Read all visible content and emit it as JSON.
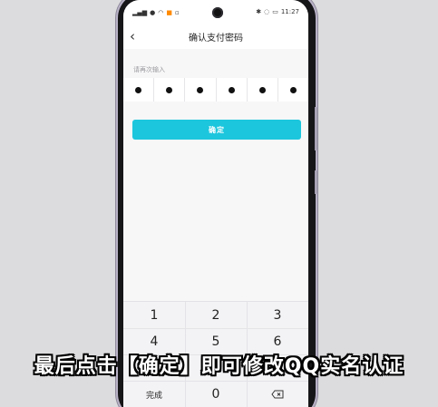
{
  "status_bar": {
    "left_icons": [
      "signal-icon",
      "signal-icon",
      "wechat-icon",
      "sms-icon",
      "wifi-icon",
      "app-icon",
      "app-icon",
      "misc-icon"
    ],
    "time": "11:27",
    "right_icons": [
      "bluetooth-icon",
      "mute-icon",
      "battery-icon"
    ]
  },
  "nav": {
    "back_icon": "chevron-left-icon",
    "title": "确认支付密码"
  },
  "form": {
    "hint": "请再次输入",
    "pin_length": 6,
    "pin_filled": 6,
    "confirm_label": "确定"
  },
  "keypad": {
    "row1": [
      "1",
      "2",
      "3"
    ],
    "row2": [
      "4",
      "5",
      "6"
    ],
    "done_label": "完成",
    "zero_label": "0",
    "delete_icon": "backspace-icon"
  },
  "caption": "最后点击【确定】即可修改QQ实名认证",
  "colors": {
    "accent": "#1cc6dd",
    "background": "#dcdcde"
  }
}
